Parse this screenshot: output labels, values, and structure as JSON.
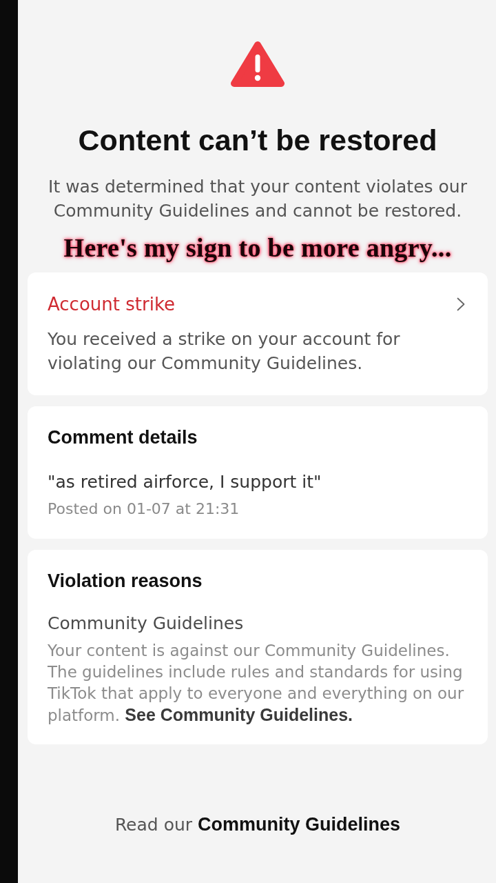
{
  "header": {
    "title": "Content can’t be restored",
    "message": "It was determined that your content violates our Community Guidelines and cannot be restored."
  },
  "caption_overlay": "Here's my sign to be more angry...",
  "cards": [
    {
      "kind": "link",
      "title": "Account strike",
      "body": "You received a strike on your account for violating our Community Guidelines."
    },
    {
      "kind": "comment",
      "title": "Comment details",
      "quote": "\"as retired airforce, I support it\"",
      "meta": "Posted on 01-07 at 21:31"
    },
    {
      "kind": "reason",
      "title": "Violation reasons",
      "subtitle": "Community Guidelines",
      "body": "Your content is against our Community Guidelines. The guidelines include rules and standards for using TikTok that apply to everyone and everything on our platform.",
      "link": "See Community Guidelines."
    }
  ],
  "footer": {
    "text": "Read our",
    "link": "Community Guidelines"
  }
}
